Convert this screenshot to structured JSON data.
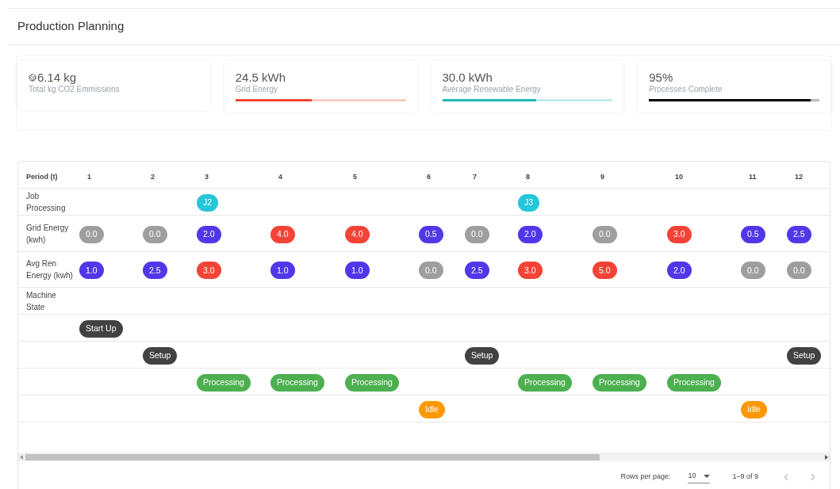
{
  "title": "Production Planning",
  "cards": [
    {
      "kind": "icon",
      "value": "6.14 kg",
      "label": "Total kg CO2 Emmissions"
    },
    {
      "kind": "progress",
      "value": "24.5 kWh",
      "label": "Grid Energy",
      "level": 0.45,
      "color": "#f44336"
    },
    {
      "kind": "progress",
      "value": "30.0 kWh",
      "label": "Average Renewable Energy",
      "level": 0.55,
      "color": "#1eb6b6"
    },
    {
      "kind": "progress",
      "value": "95%",
      "label": "Processes Complete",
      "level": 0.95,
      "color": "#000000"
    }
  ],
  "table": {
    "columns": [
      "Period (t)",
      "1",
      "2",
      "3",
      "4",
      "5",
      "6",
      "7",
      "8",
      "9",
      "10",
      "11",
      "12"
    ],
    "rows": [
      {
        "cells": [
          {
            "kind": "label",
            "text": "Job Processing"
          },
          "",
          "",
          {
            "kind": "chip",
            "text": "J2",
            "color": "#26c6da"
          },
          "",
          "",
          "",
          "",
          {
            "kind": "chip",
            "text": "J3",
            "color": "#26c6da"
          },
          "",
          "",
          "",
          ""
        ]
      },
      {
        "cells": [
          {
            "kind": "label",
            "text": "Grid Energy (kwh)"
          },
          {
            "kind": "chip",
            "text": "0.0",
            "color": "#9e9e9e"
          },
          {
            "kind": "chip",
            "text": "0.0",
            "color": "#9e9e9e"
          },
          {
            "kind": "chip",
            "text": "2.0",
            "color": "#5038e8"
          },
          {
            "kind": "chip",
            "text": "4.0",
            "color": "#f44336"
          },
          {
            "kind": "chip",
            "text": "4.0",
            "color": "#f44336"
          },
          {
            "kind": "chip",
            "text": "0.5",
            "color": "#5038e8"
          },
          {
            "kind": "chip",
            "text": "0.0",
            "color": "#9e9e9e"
          },
          {
            "kind": "chip",
            "text": "2.0",
            "color": "#5038e8"
          },
          {
            "kind": "chip",
            "text": "0.0",
            "color": "#9e9e9e"
          },
          {
            "kind": "chip",
            "text": "3.0",
            "color": "#f44336"
          },
          {
            "kind": "chip",
            "text": "0.5",
            "color": "#5038e8"
          },
          {
            "kind": "chip",
            "text": "2.5",
            "color": "#5038e8"
          }
        ]
      },
      {
        "cells": [
          {
            "kind": "label",
            "text": "Avg Ren Energy (kwh)"
          },
          {
            "kind": "chip",
            "text": "1.0",
            "color": "#5038e8"
          },
          {
            "kind": "chip",
            "text": "2.5",
            "color": "#5038e8"
          },
          {
            "kind": "chip",
            "text": "3.0",
            "color": "#f44336"
          },
          {
            "kind": "chip",
            "text": "1.0",
            "color": "#5038e8"
          },
          {
            "kind": "chip",
            "text": "1.0",
            "color": "#5038e8"
          },
          {
            "kind": "chip",
            "text": "0.0",
            "color": "#9e9e9e"
          },
          {
            "kind": "chip",
            "text": "2.5",
            "color": "#5038e8"
          },
          {
            "kind": "chip",
            "text": "3.0",
            "color": "#f44336"
          },
          {
            "kind": "chip",
            "text": "5.0",
            "color": "#f44336"
          },
          {
            "kind": "chip",
            "text": "2.0",
            "color": "#5038e8"
          },
          {
            "kind": "chip",
            "text": "0.0",
            "color": "#9e9e9e"
          },
          {
            "kind": "chip",
            "text": "0.0",
            "color": "#9e9e9e"
          }
        ]
      },
      {
        "cells": [
          {
            "kind": "label",
            "text": "Machine State"
          },
          "",
          "",
          "",
          "",
          "",
          "",
          "",
          "",
          "",
          "",
          "",
          ""
        ]
      },
      {
        "cells": [
          "",
          {
            "kind": "chip",
            "text": "Start Up",
            "color": "#424242"
          },
          "",
          "",
          "",
          "",
          "",
          "",
          "",
          "",
          "",
          "",
          ""
        ]
      },
      {
        "cells": [
          "",
          "",
          {
            "kind": "chip",
            "text": "Setup",
            "color": "#424242"
          },
          "",
          "",
          "",
          "",
          {
            "kind": "chip",
            "text": "Setup",
            "color": "#424242"
          },
          "",
          "",
          "",
          "",
          {
            "kind": "chip",
            "text": "Setup",
            "color": "#424242"
          }
        ]
      },
      {
        "cells": [
          "",
          "",
          "",
          {
            "kind": "chip",
            "text": "Processing",
            "color": "#4caf50"
          },
          {
            "kind": "chip",
            "text": "Processing",
            "color": "#4caf50"
          },
          {
            "kind": "chip",
            "text": "Processing",
            "color": "#4caf50"
          },
          "",
          "",
          {
            "kind": "chip",
            "text": "Processing",
            "color": "#4caf50"
          },
          {
            "kind": "chip",
            "text": "Processing",
            "color": "#4caf50"
          },
          {
            "kind": "chip",
            "text": "Processing",
            "color": "#4caf50"
          },
          "",
          ""
        ]
      },
      {
        "cells": [
          "",
          "",
          "",
          "",
          "",
          "",
          {
            "kind": "chip",
            "text": "Idle",
            "color": "#ff9800"
          },
          "",
          "",
          "",
          "",
          {
            "kind": "chip",
            "text": "Idle",
            "color": "#ff9800"
          },
          ""
        ]
      }
    ]
  },
  "pagination": {
    "rows_label": "Rows per page:",
    "rows_value": "10",
    "range": "1–9 of 9"
  }
}
